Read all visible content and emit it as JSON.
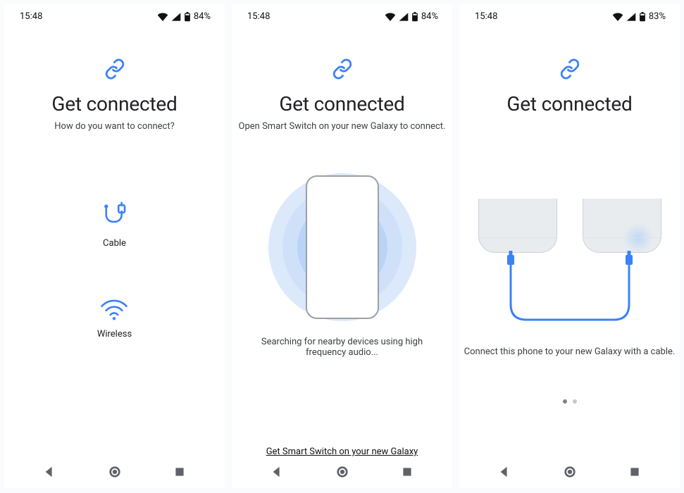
{
  "screens": [
    {
      "status": {
        "time": "15:48",
        "battery": "84%"
      },
      "title": "Get connected",
      "subtitle": "How do you want to connect?",
      "options": [
        {
          "icon": "cable",
          "label": "Cable"
        },
        {
          "icon": "wireless",
          "label": "Wireless"
        }
      ]
    },
    {
      "status": {
        "time": "15:48",
        "battery": "84%"
      },
      "title": "Get connected",
      "subtitle": "Open Smart Switch on your new Galaxy to connect.",
      "searching_text": "Searching for nearby devices using high frequency audio...",
      "cta": "Get Smart Switch on your new Galaxy"
    },
    {
      "status": {
        "time": "15:48",
        "battery": "83%"
      },
      "title": "Get connected",
      "subtitle": "",
      "connect_text": "Connect this phone to your new Galaxy with a cable.",
      "page_indicator": {
        "current": 0,
        "total": 2
      }
    }
  ],
  "icons": {
    "link": "link-icon",
    "cable": "cable-icon",
    "wifi": "wifi-icon",
    "back": "nav-back-icon",
    "home": "nav-home-icon",
    "recent": "nav-recent-icon"
  },
  "accent": "#3b82f6"
}
